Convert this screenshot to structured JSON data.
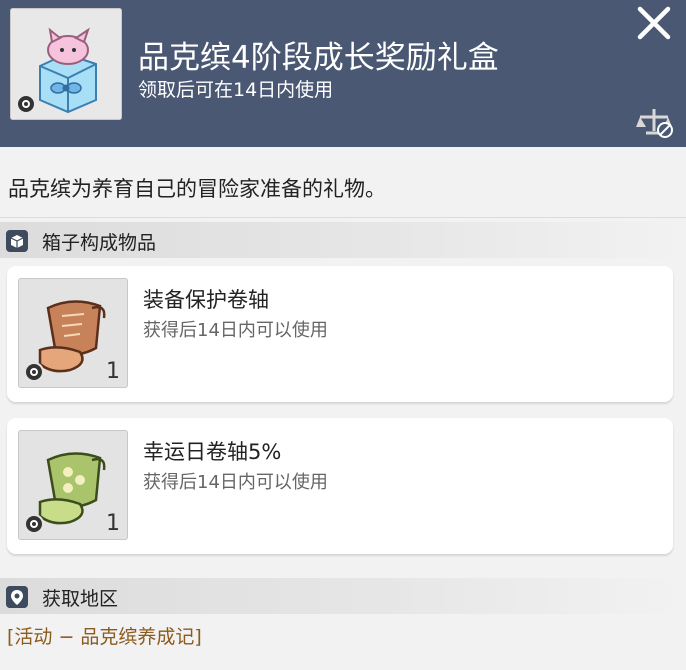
{
  "header": {
    "title": "品克缤4阶段成长奖励礼盒",
    "subtitle": "领取后可在14日内使用",
    "bg_color": "#4a5873"
  },
  "description": "品克缤为养育自己的冒险家准备的礼物。",
  "contents_section": {
    "label": "箱子构成物品",
    "items": [
      {
        "name": "装备保护卷轴",
        "sub": "获得后14日内可以使用",
        "qty": "1",
        "icon": "scroll-brown-icon"
      },
      {
        "name": "幸运日卷轴5%",
        "sub": "获得后14日内可以使用",
        "qty": "1",
        "icon": "scroll-green-icon"
      }
    ]
  },
  "region_section": {
    "label": "获取地区",
    "value": "[活动 − 品克缤养成记]"
  }
}
